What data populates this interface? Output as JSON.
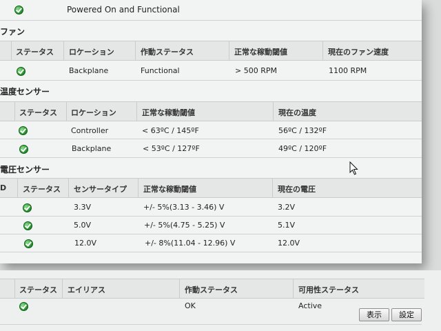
{
  "power": {
    "status_text": "Powered On and Functional"
  },
  "fans": {
    "title": "ファン",
    "headers": [
      "ステータス",
      "ロケーション",
      "作動ステータス",
      "正常な稼動閾値",
      "現在のファン速度"
    ],
    "rows": [
      {
        "location": "Backplane",
        "operational": "Functional",
        "threshold": "> 500 RPM",
        "speed": "1100 RPM"
      }
    ]
  },
  "temperature": {
    "title": "温度センサー",
    "headers": [
      "ステータス",
      "ロケーション",
      "正常な稼動閾値",
      "現在の温度"
    ],
    "rows": [
      {
        "location": "Controller",
        "threshold": "< 63ºC / 145ºF",
        "current": "56ºC / 132ºF"
      },
      {
        "location": "Backplane",
        "threshold": "< 53ºC / 127ºF",
        "current": "49ºC / 120ºF"
      }
    ]
  },
  "voltage": {
    "title": "電圧センサー",
    "headers": [
      "D",
      "ステータス",
      "センサータイプ",
      "正常な稼動閾値",
      "現在の電圧"
    ],
    "rows": [
      {
        "type": "3.3V",
        "threshold": "+/- 5%(3.13 - 3.46) V",
        "current": "3.2V"
      },
      {
        "type": "5.0V",
        "threshold": "+/- 5%(4.75 - 5.25) V",
        "current": "5.1V"
      },
      {
        "type": "12.0V",
        "threshold": "+/- 8%(11.04 - 12.96) V",
        "current": "12.0V"
      }
    ]
  },
  "disks": {
    "headers": [
      "ステータス",
      "エイリアス",
      "作動ステータス",
      "可用性ステータス"
    ],
    "rows": [
      {
        "alias": "",
        "operational": "OK",
        "availability": "Active"
      }
    ],
    "buttons": {
      "show": "表示",
      "settings": "設定"
    }
  },
  "icons": {
    "status_ok": "status-ok-icon",
    "pointer": "mouse-pointer-icon"
  },
  "colors": {
    "ok_green": "#1f8a2a",
    "panel": "#f2f3f3",
    "header": "#e4e7e6"
  }
}
